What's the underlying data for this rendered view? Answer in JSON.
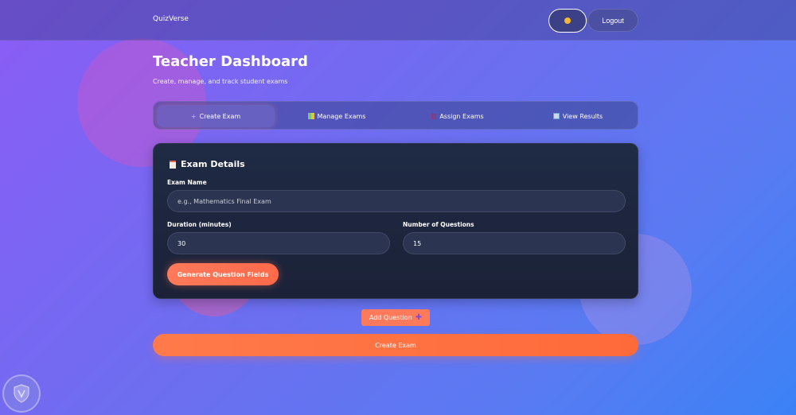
{
  "navbar": {
    "brand": "QuizVerse",
    "logout_label": "Logout"
  },
  "header": {
    "title": "Teacher Dashboard",
    "subtitle": "Create, manage, and track student exams"
  },
  "tabs": [
    {
      "label": "Create Exam",
      "icon": "plus-icon",
      "active": true
    },
    {
      "label": "Manage Exams",
      "icon": "books-icon",
      "active": false
    },
    {
      "label": "Assign Exams",
      "icon": "bar-icon",
      "active": false
    },
    {
      "label": "View Results",
      "icon": "chart-icon",
      "active": false
    }
  ],
  "exam_form": {
    "title": "Exam Details",
    "exam_name_label": "Exam Name",
    "exam_name_placeholder": "e.g., Mathematics Final Exam",
    "duration_label": "Duration (minutes)",
    "duration_value": "30",
    "questions_label": "Number of Questions",
    "questions_value": "15",
    "generate_label": "Generate Question Fields"
  },
  "actions": {
    "add_question_label": "Add Question",
    "create_exam_label": "Create Exam"
  },
  "colors": {
    "accent": "#ff7a5a",
    "card_bg": "#1f2a44",
    "theme_icon": "#f5b82e"
  }
}
